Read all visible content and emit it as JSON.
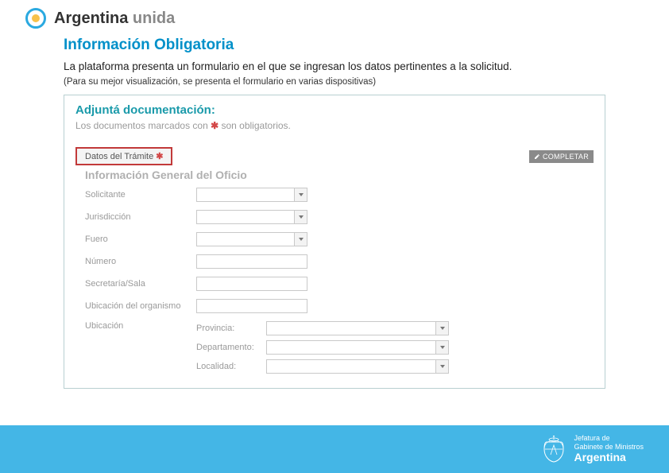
{
  "brand": {
    "word1": "Argentina",
    "word2": "unida"
  },
  "slide": {
    "title": "Información Obligatoria",
    "intro": "La plataforma presenta un formulario en el que se ingresan los datos pertinentes a la solicitud.",
    "note": "(Para su mejor visualización, se presenta el formulario en varias dispositivas)"
  },
  "form": {
    "heading": "Adjuntá documentación:",
    "sub_prefix": "Los documentos marcados con ",
    "sub_suffix": " son obligatorios.",
    "asterisk": "✱",
    "section_label": "Datos del Trámite ",
    "completar": "COMPLETAR",
    "sub_heading": "Información General del Oficio",
    "fields": {
      "solicitante": "Solicitante",
      "jurisdiccion": "Jurisdicción",
      "fuero": "Fuero",
      "numero": "Número",
      "secretaria": "Secretaría/Sala",
      "ubic_org": "Ubicación del organismo",
      "ubicacion": "Ubicación",
      "provincia": "Provincia:",
      "departamento": "Departamento:",
      "localidad": "Localidad:"
    }
  },
  "footer": {
    "line1": "Jefatura de",
    "line2": "Gabinete de Ministros",
    "line3": "Argentina"
  }
}
